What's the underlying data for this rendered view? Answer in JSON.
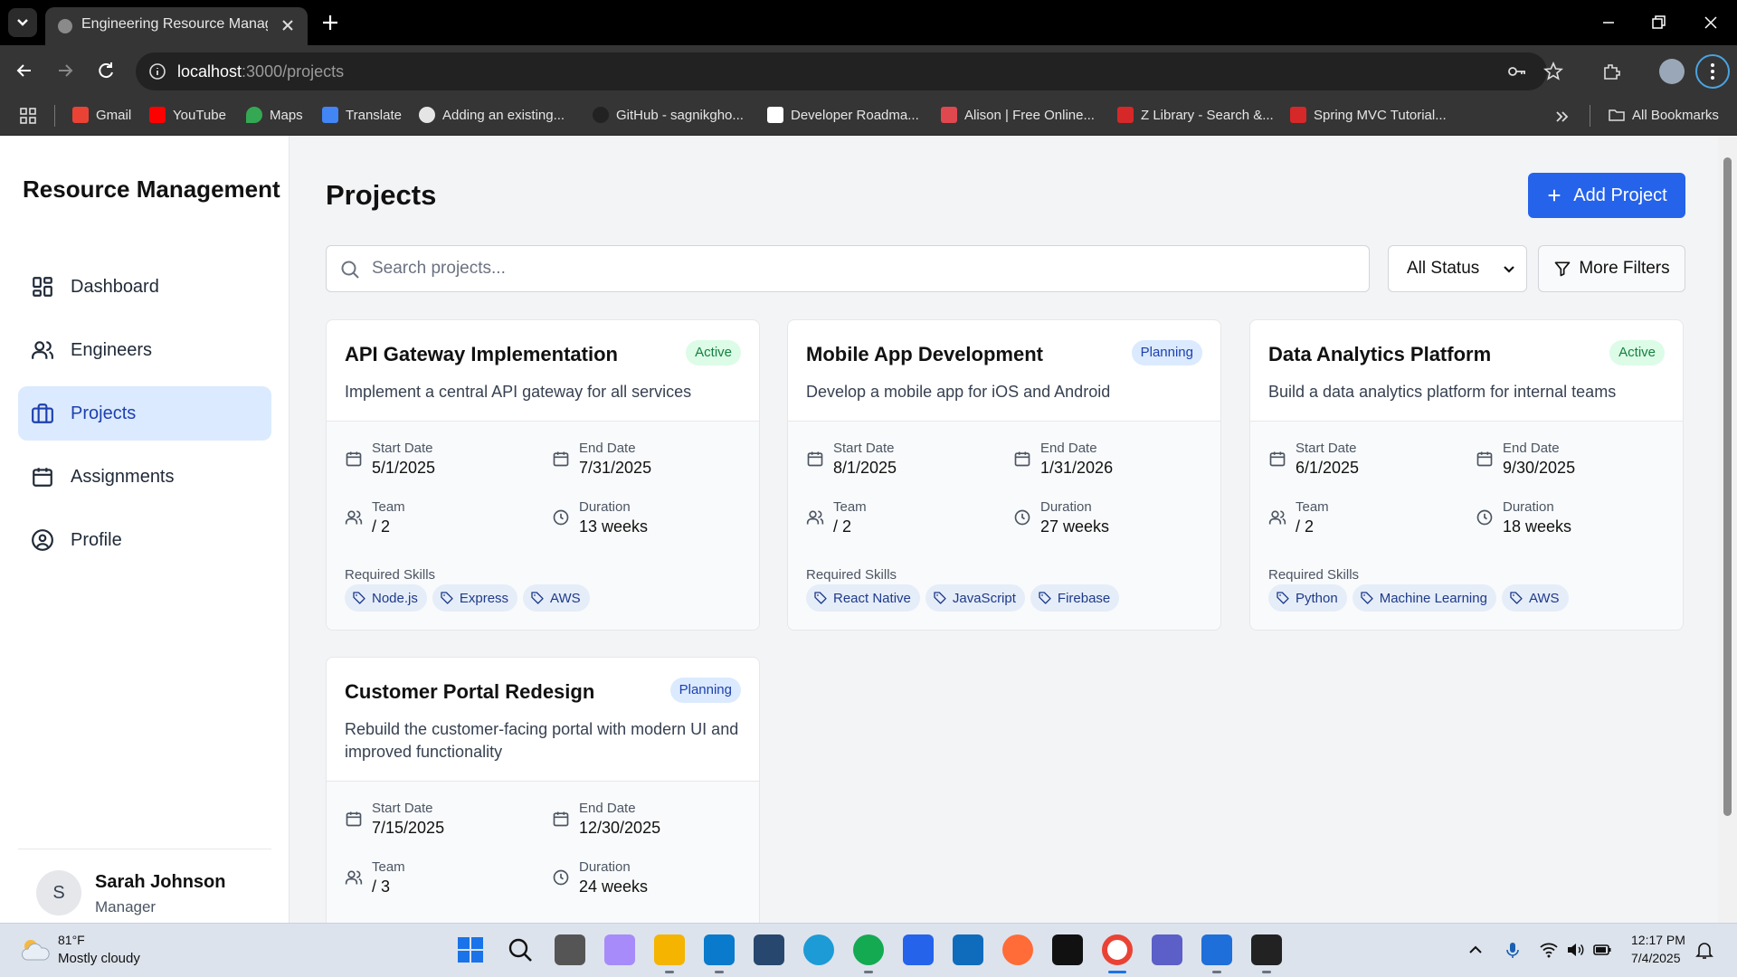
{
  "browser": {
    "tab_title": "Engineering Resource Managem",
    "url_host": "localhost",
    "url_path": ":3000/projects",
    "bookmarks": [
      {
        "label": "Gmail",
        "color": "#ea4335"
      },
      {
        "label": "YouTube",
        "color": "#ff0000"
      },
      {
        "label": "Maps",
        "color": "#34a853"
      },
      {
        "label": "Translate",
        "color": "#4285f4"
      },
      {
        "label": "Adding an existing...",
        "color": "#e5e5e5"
      },
      {
        "label": "GitHub - sagnikgho...",
        "color": "#222222"
      },
      {
        "label": "Developer Roadma...",
        "color": "#ffffff"
      },
      {
        "label": "Alison | Free Online...",
        "color": "#e0484f"
      },
      {
        "label": "Z Library - Search &...",
        "color": "#d62828"
      },
      {
        "label": "Spring MVC Tutorial...",
        "color": "#d62828"
      }
    ],
    "all_bookmarks": "All Bookmarks"
  },
  "sidebar": {
    "brand": "Resource Management",
    "items": [
      {
        "label": "Dashboard",
        "icon": "dashboard-icon"
      },
      {
        "label": "Engineers",
        "icon": "users-icon"
      },
      {
        "label": "Projects",
        "icon": "briefcase-icon",
        "active": true
      },
      {
        "label": "Assignments",
        "icon": "calendar-icon"
      },
      {
        "label": "Profile",
        "icon": "user-circle-icon"
      }
    ],
    "user": {
      "initial": "S",
      "name": "Sarah Johnson",
      "role": "Manager"
    }
  },
  "main": {
    "title": "Projects",
    "add_label": "Add Project",
    "search_placeholder": "Search projects...",
    "status_filter": "All Status",
    "more_filters": "More Filters",
    "labels": {
      "start": "Start Date",
      "end": "End Date",
      "team": "Team",
      "duration": "Duration",
      "skills": "Required Skills"
    },
    "projects": [
      {
        "title": "API Gateway Implementation",
        "status": "Active",
        "description": "Implement a central API gateway for all services",
        "start": "5/1/2025",
        "end": "7/31/2025",
        "team": "/ 2",
        "duration": "13 weeks",
        "skills": [
          "Node.js",
          "Express",
          "AWS"
        ]
      },
      {
        "title": "Mobile App Development",
        "status": "Planning",
        "description": "Develop a mobile app for iOS and Android",
        "start": "8/1/2025",
        "end": "1/31/2026",
        "team": "/ 2",
        "duration": "27 weeks",
        "skills": [
          "React Native",
          "JavaScript",
          "Firebase"
        ]
      },
      {
        "title": "Data Analytics Platform",
        "status": "Active",
        "description": "Build a data analytics platform for internal teams",
        "start": "6/1/2025",
        "end": "9/30/2025",
        "team": "/ 2",
        "duration": "18 weeks",
        "skills": [
          "Python",
          "Machine Learning",
          "AWS"
        ]
      },
      {
        "title": "Customer Portal Redesign",
        "status": "Planning",
        "description": "Rebuild the customer-facing portal with modern UI and improved functionality",
        "start": "7/15/2025",
        "end": "12/30/2025",
        "team": "/ 3",
        "duration": "24 weeks",
        "skills": []
      }
    ]
  },
  "taskbar": {
    "temperature": "81°F",
    "weather": "Mostly cloudy",
    "time": "12:17 PM",
    "date": "7/4/2025"
  }
}
